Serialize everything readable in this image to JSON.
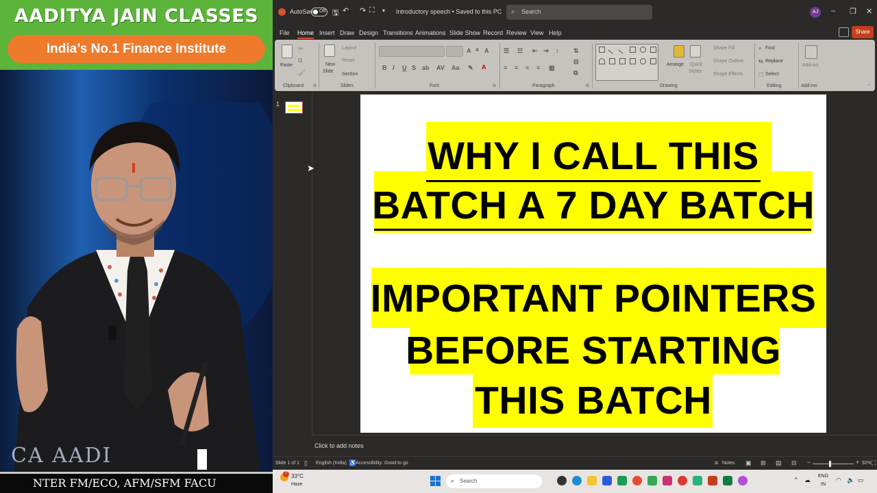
{
  "video": {
    "brand_title": "AADITYA JAIN CLASSES",
    "brand_tagline": "India’s No.1 Finance Institute",
    "watermark": "CA AADI",
    "ticker": "NTER FM/ECO, AFM/SFM FACU"
  },
  "ppt": {
    "titlebar": {
      "autosave_label": "AutoSave",
      "autosave_state": "Off",
      "doc_title": "Introductory speech • Saved to this PC",
      "search_placeholder": "Search",
      "avatar_initials": "AJ"
    },
    "tabs": [
      "File",
      "Home",
      "Insert",
      "Draw",
      "Design",
      "Transitions",
      "Animations",
      "Slide Show",
      "Record",
      "Review",
      "View",
      "Help"
    ],
    "active_tab": "Home",
    "share_label": "Share",
    "ribbon": {
      "groups": [
        "Clipboard",
        "Slides",
        "Font",
        "Paragraph",
        "Drawing",
        "Editing",
        "Add-ins"
      ],
      "paste": "Paste",
      "new_slide_line1": "New",
      "new_slide_line2": "Slide",
      "layout": "Layout",
      "reset": "Reset",
      "section": "Section",
      "arrange": "Arrange",
      "quick_styles_line1": "Quick",
      "quick_styles_line2": "Styles",
      "shape_fill": "Shape Fill",
      "shape_outline": "Shape Outline",
      "shape_effects": "Shape Effects",
      "find": "Find",
      "replace": "Replace",
      "select": "Select",
      "addins": "Add-ins"
    },
    "thumbnail_number": "1",
    "slide": {
      "heading_line1": "WHY I CALL THIS",
      "heading_line2": "BATCH A 7 DAY BATCH",
      "sub_line1": "IMPORTANT POINTERS",
      "sub_line2": "BEFORE STARTING",
      "sub_line3": "THIS BATCH"
    },
    "notes_placeholder": "Click to add notes",
    "status": {
      "slide_count": "Slide 1 of 1",
      "language": "English (India)",
      "accessibility": "Accessibility: Good to go",
      "notes": "Notes",
      "zoom": "92%"
    }
  },
  "taskbar": {
    "weather_badge": "7",
    "temperature": "33°C",
    "condition": "Haze",
    "search_placeholder": "Search",
    "lang_line1": "ENG",
    "lang_line2": "IN"
  },
  "colors": {
    "brand_green": "#5db43a",
    "brand_orange": "#ee7a2c",
    "slide_highlight": "#ffff00",
    "ppt_accent": "#d35230"
  }
}
